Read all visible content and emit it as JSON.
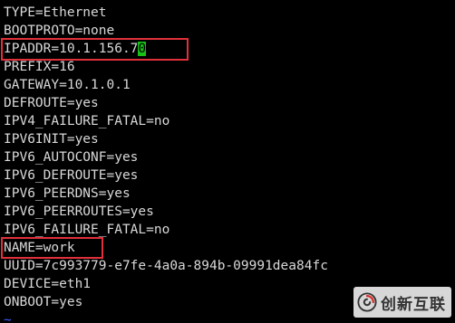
{
  "terminal": {
    "lines": [
      "TYPE=Ethernet",
      "BOOTPROTO=none",
      "IPADDR=10.1.156.7",
      "PREFIX=16",
      "GATEWAY=10.1.0.1",
      "DEFROUTE=yes",
      "IPV4_FAILURE_FATAL=no",
      "IPV6INIT=yes",
      "IPV6_AUTOCONF=yes",
      "IPV6_DEFROUTE=yes",
      "IPV6_PEERDNS=yes",
      "IPV6_PEERROUTES=yes",
      "IPV6_FAILURE_FATAL=no",
      "NAME=work",
      "UUID=7c993779-e7fe-4a0a-894b-09991dea84fc",
      "DEVICE=eth1",
      "ONBOOT=yes"
    ],
    "cursor_char": "0",
    "tilde": "~"
  },
  "watermark": {
    "text": "创新互联",
    "icon": "swirl-logo-icon"
  },
  "colors": {
    "background": "#000000",
    "text": "#d8d8d8",
    "cursor": "#18c018",
    "highlight_box": "#e0303a",
    "tilde": "#3b5cff"
  }
}
